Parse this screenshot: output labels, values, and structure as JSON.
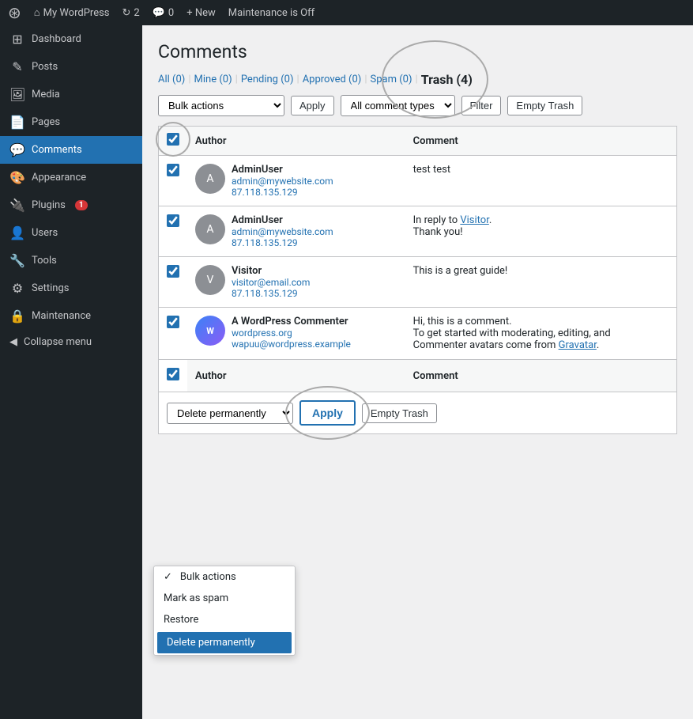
{
  "topbar": {
    "wp_logo": "⚙",
    "site_name": "My WordPress",
    "updates_count": "2",
    "comments_count": "0",
    "new_label": "+ New",
    "maintenance_label": "Maintenance is Off"
  },
  "sidebar": {
    "items": [
      {
        "id": "dashboard",
        "icon": "⊞",
        "label": "Dashboard"
      },
      {
        "id": "posts",
        "icon": "✎",
        "label": "Posts"
      },
      {
        "id": "media",
        "icon": "🖼",
        "label": "Media"
      },
      {
        "id": "pages",
        "icon": "📄",
        "label": "Pages"
      },
      {
        "id": "comments",
        "icon": "💬",
        "label": "Comments",
        "active": true
      },
      {
        "id": "appearance",
        "icon": "🎨",
        "label": "Appearance"
      },
      {
        "id": "plugins",
        "icon": "🔌",
        "label": "Plugins",
        "badge": "1"
      },
      {
        "id": "users",
        "icon": "👤",
        "label": "Users"
      },
      {
        "id": "tools",
        "icon": "🔧",
        "label": "Tools"
      },
      {
        "id": "settings",
        "icon": "⚙",
        "label": "Settings"
      },
      {
        "id": "maintenance",
        "icon": "🔒",
        "label": "Maintenance"
      }
    ],
    "collapse_label": "Collapse menu"
  },
  "page": {
    "title": "Comments",
    "filter_links": [
      {
        "label": "All",
        "count": "(0)",
        "active": false
      },
      {
        "label": "Mine",
        "count": "(0)",
        "active": false
      },
      {
        "label": "Pending",
        "count": "(0)",
        "active": false
      },
      {
        "label": "Approved",
        "count": "(0)",
        "active": false
      },
      {
        "label": "Spam",
        "count": "(0)",
        "active": false
      },
      {
        "label": "Trash",
        "count": "(4)",
        "active": true
      }
    ],
    "toolbar": {
      "bulk_actions_label": "Bulk actions",
      "apply_label": "Apply",
      "comment_type_placeholder": "All comment typ…",
      "empty_trash_label": "Empty Trash",
      "filter_label": "Filter"
    },
    "table": {
      "headers": [
        {
          "label": "Author",
          "col": "author"
        },
        {
          "label": "Comment",
          "col": "comment"
        }
      ],
      "rows": [
        {
          "id": 1,
          "checked": true,
          "author_name": "AdminUser",
          "author_email": "admin@mywebsite.com",
          "author_ip": "87.118.135.129",
          "avatar_type": "letter",
          "avatar_letter": "A",
          "avatar_color": "#8c8f94",
          "comment": "test test",
          "reply_text": "",
          "reply_link": ""
        },
        {
          "id": 2,
          "checked": true,
          "author_name": "AdminUser",
          "author_email": "admin@mywebsite.com",
          "author_ip": "87.118.135.129",
          "avatar_type": "letter",
          "avatar_letter": "A",
          "avatar_color": "#8c8f94",
          "comment": "Thank you!",
          "reply_text": "In reply to",
          "reply_link": "Visitor"
        },
        {
          "id": 3,
          "checked": true,
          "author_name": "Visitor",
          "author_email": "visitor@email.com",
          "author_ip": "87.118.135.129",
          "avatar_type": "letter",
          "avatar_letter": "V",
          "avatar_color": "#8c8f94",
          "comment": "This is a great guide!",
          "reply_text": "",
          "reply_link": ""
        },
        {
          "id": 4,
          "checked": true,
          "author_name": "A WordPress Commenter",
          "author_email": "wordpress.org",
          "author_ip": "wapuu@wordpress.example",
          "avatar_type": "wp",
          "avatar_letter": "W",
          "avatar_color": "#3b82f6",
          "comment_line1": "Hi, this is a comment.",
          "comment_line2": "To get started with moderating, editing, and",
          "comment_line3": "Commenter avatars come from",
          "comment_gravatar": "Gravatar",
          "reply_text": "",
          "reply_link": ""
        }
      ]
    },
    "dropdown": {
      "items": [
        {
          "label": "Bulk actions",
          "checked": true,
          "active": false
        },
        {
          "label": "Mark as spam",
          "checked": false,
          "active": false
        },
        {
          "label": "Restore",
          "checked": false,
          "active": false
        },
        {
          "label": "Delete permanently",
          "checked": false,
          "active": true
        }
      ]
    },
    "bottom_toolbar": {
      "apply_label": "Apply",
      "empty_trash_label": "Empty Trash"
    }
  }
}
